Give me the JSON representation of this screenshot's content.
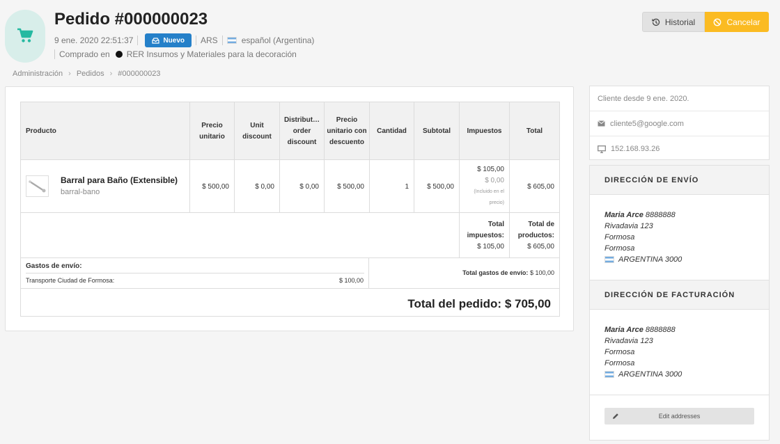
{
  "header": {
    "title": "Pedido #000000023",
    "date": "9 ene. 2020 22:51:37",
    "status": "Nuevo",
    "currency": "ARS",
    "language": "español (Argentina)",
    "purchased_in_label": "Comprado en",
    "store_name": "RER Insumos y Materiales para la decoración",
    "accent_color": "#25b9a1",
    "status_color": "#2580c9"
  },
  "actions": {
    "history_label": "Historial",
    "cancel_label": "Cancelar",
    "cancel_color": "#fbbb22"
  },
  "breadcrumb": [
    "Administración",
    "Pedidos",
    "#000000023"
  ],
  "table": {
    "columns": [
      "Producto",
      "Precio unitario",
      "Unit discount",
      "Distribut… order discount",
      "Precio unitario con descuento",
      "Cantidad",
      "Subtotal",
      "Impuestos",
      "Total"
    ],
    "product": {
      "name": "Barral para Baño (Extensible)",
      "reference": "barral-bano",
      "unit_price": "$ 500,00",
      "unit_discount": "$ 0,00",
      "order_discount": "$ 0,00",
      "discounted_price": "$ 500,00",
      "quantity": "1",
      "subtotal": "$ 500,00",
      "tax_amount": "$ 105,00",
      "tax_sub": "$ 0,00",
      "tax_note_1": "(Incluido en el",
      "tax_note_2": "precio)",
      "total": "$ 605,00"
    },
    "totals": {
      "tax_label_1": "Total",
      "tax_label_2": "impuestos:",
      "tax_value": "$ 105,00",
      "products_label_1": "Total de",
      "products_label_2": "productos:",
      "products_value": "$ 605,00"
    },
    "shipping": {
      "title": "Gastos de envío:",
      "carrier": "Transporte Ciudad de Formosa:",
      "price": "$ 100,00",
      "total_label": "Total gastos de envío:",
      "total_value": "$ 100,00"
    },
    "grand_total": "Total del pedido: $ 705,00"
  },
  "customer": {
    "since": "Cliente desde 9 ene. 2020.",
    "email": "cliente5@google.com",
    "ip": "152.168.93.26"
  },
  "shipping_address": {
    "heading": "DIRECCIÓN DE ENVÍO",
    "name": "Maria Arce",
    "phone": "8888888",
    "street": "Rivadavia 123",
    "city": "Formosa",
    "state": "Formosa",
    "country": "ARGENTINA 3000"
  },
  "billing_address": {
    "heading": "DIRECCIÓN DE FACTURACIÓN",
    "name": "Maria Arce",
    "phone": "8888888",
    "street": "Rivadavia 123",
    "city": "Formosa",
    "state": "Formosa",
    "country": "ARGENTINA 3000"
  },
  "edit_addresses_label": "Edit addresses"
}
